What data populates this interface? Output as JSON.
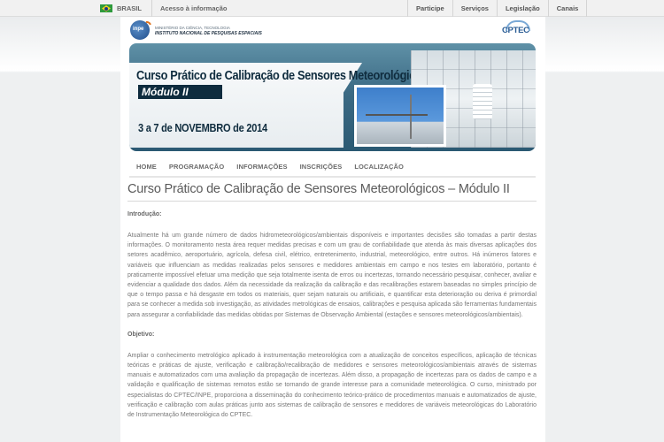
{
  "govbar": {
    "country": "BRASIL",
    "access": "Acesso à informação",
    "links": [
      "Participe",
      "Serviços",
      "Legislação",
      "Canais"
    ]
  },
  "header": {
    "inpe_line1": "MINISTÉRIO DA CIÊNCIA, TECNOLOGIA",
    "inpe_line2": "INSTITUTO NACIONAL DE PESQUISAS ESPACIAIS",
    "inpe_mark": "inpe",
    "cptec": "CPTEC"
  },
  "banner": {
    "title": "Curso Prático de Calibração de Sensores Meteorológicos",
    "module": "Módulo II",
    "dates": "3 a 7 de NOVEMBRO de 2014"
  },
  "nav": [
    "HOME",
    "PROGRAMAÇÃO",
    "INFORMAÇÕES",
    "INSCRIÇÕES",
    "LOCALIZAÇÃO"
  ],
  "content": {
    "title": "Curso Prático de Calibração de Sensores Meteorológicos – Módulo II",
    "intro_label": "Introdução:",
    "intro_text": "Atualmente há um grande número de dados hidrometeorológicos/ambientais disponíveis e importantes decisões são tomadas a partir destas informações. O monitoramento nesta área requer medidas precisas e com um grau de confiabilidade que atenda às mais diversas aplicações dos setores acadêmico, aeroportuário, agrícola, defesa civil, elétrico, entretenimento, industrial, meteorológico, entre outros. Há inúmeros fatores e variáveis que influenciam as medidas realizadas pelos sensores e medidores ambientais em campo e nos testes em laboratório, portanto é praticamente impossível efetuar uma medição que seja totalmente isenta de erros ou incertezas, tornando necessário pesquisar, conhecer, avaliar e evidenciar a qualidade dos dados. Além da necessidade da realização da calibração e das recalibrações estarem baseadas no simples princípio de que o tempo passa e há desgaste em todos os materiais, quer sejam naturais ou artificiais, e quantificar esta deterioração ou deriva é primordial para se conhecer a medida sob investigação, as atividades metrológicas de ensaios, calibrações e pesquisa aplicada são ferramentas fundamentais para assegurar a confiabilidade das medidas obtidas por Sistemas de Observação Ambiental (estações e sensores meteorológicos/ambientais).",
    "objective_label": "Objetivo:",
    "objective_text": "Ampliar o conhecimento metrológico aplicado à instrumentação meteorológica com a atualização de conceitos específicos, aplicação de técnicas teóricas e práticas de ajuste, verificação e calibração/recalibração de medidores e sensores meteorológicos/ambientais através de sistemas manuais e automatizados com uma avaliação da propagação de incertezas. Além disso, a propagação de incertezas para os dados de campo e a validação e qualificação de sistemas remotos estão se tornando de grande interesse para a comunidade meteorológica. O curso, ministrado por especialistas do CPTEC/INPE, proporciona a disseminação do conhecimento teórico-prático de procedimentos manuais e automatizados de ajuste, verificação e calibração com aulas práticas junto aos sistemas de calibração de sensores e medidores de variáveis meteorológicas do Laboratório de Instrumentação Meteorológica do CPTEC."
  }
}
